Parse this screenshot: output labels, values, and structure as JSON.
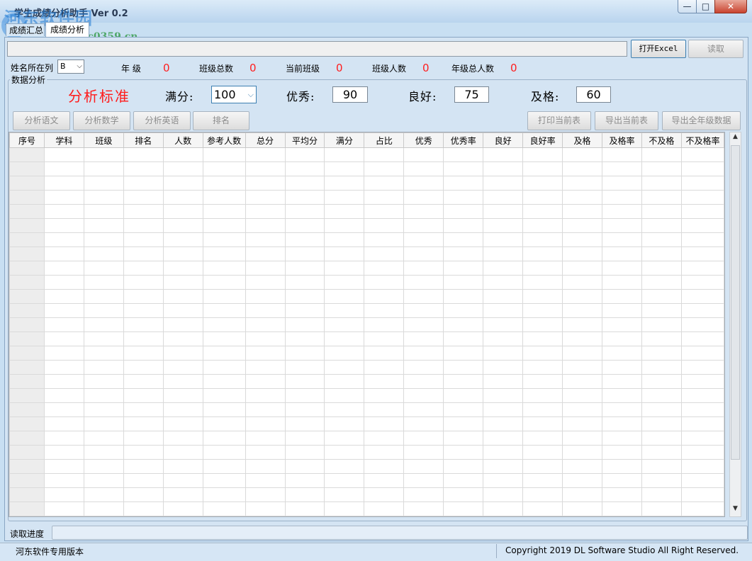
{
  "window": {
    "title": "学生成绩分析助手 Ver 0.2",
    "controls": {
      "minimize": "—",
      "maximize": "□",
      "close": "✕"
    }
  },
  "watermark": {
    "site_name": "河东软件园",
    "url": "www.pc0359.cn"
  },
  "tabs": [
    {
      "label": "成绩汇总",
      "active": false
    },
    {
      "label": "成绩分析",
      "active": true
    }
  ],
  "file": {
    "path_value": "",
    "open_button": "打开Excel",
    "read_button": "读取"
  },
  "info": {
    "name_col_label": "姓名所在列",
    "name_col_value": "B",
    "grade_label": "年  级",
    "grade_value": "0",
    "class_total_label": "班级总数",
    "class_total_value": "0",
    "current_class_label": "当前班级",
    "current_class_value": "0",
    "class_count_label": "班级人数",
    "class_count_value": "0",
    "grade_count_label": "年级总人数",
    "grade_count_value": "0"
  },
  "analysis": {
    "group_title": "数据分析",
    "standard_title": "分析标准",
    "full_label": "满分:",
    "full_value": "100",
    "excellent_label": "优秀:",
    "excellent_value": "90",
    "good_label": "良好:",
    "good_value": "75",
    "pass_label": "及格:",
    "pass_value": "60",
    "buttons": {
      "chinese": "分析语文",
      "math": "分析数学",
      "english": "分析英语",
      "rank": "排名",
      "print": "打印当前表",
      "export_current": "导出当前表",
      "export_all": "导出全年级数据"
    }
  },
  "table": {
    "columns": [
      "序号",
      "学科",
      "班级",
      "排名",
      "人数",
      "参考人数",
      "总分",
      "平均分",
      "满分",
      "占比",
      "优秀",
      "优秀率",
      "良好",
      "良好率",
      "及格",
      "及格率",
      "不及格",
      "不及格率"
    ],
    "rows": []
  },
  "progress": {
    "label": "读取进度",
    "value": 0
  },
  "status": {
    "left": "河东软件专用版本",
    "right": "Copyright 2019 DL Software Studio All Right Reserved."
  },
  "colors": {
    "accent_red": "#ff1e1e",
    "progress_green": "#3fae4a",
    "window_bg": "#d4e4f3"
  }
}
